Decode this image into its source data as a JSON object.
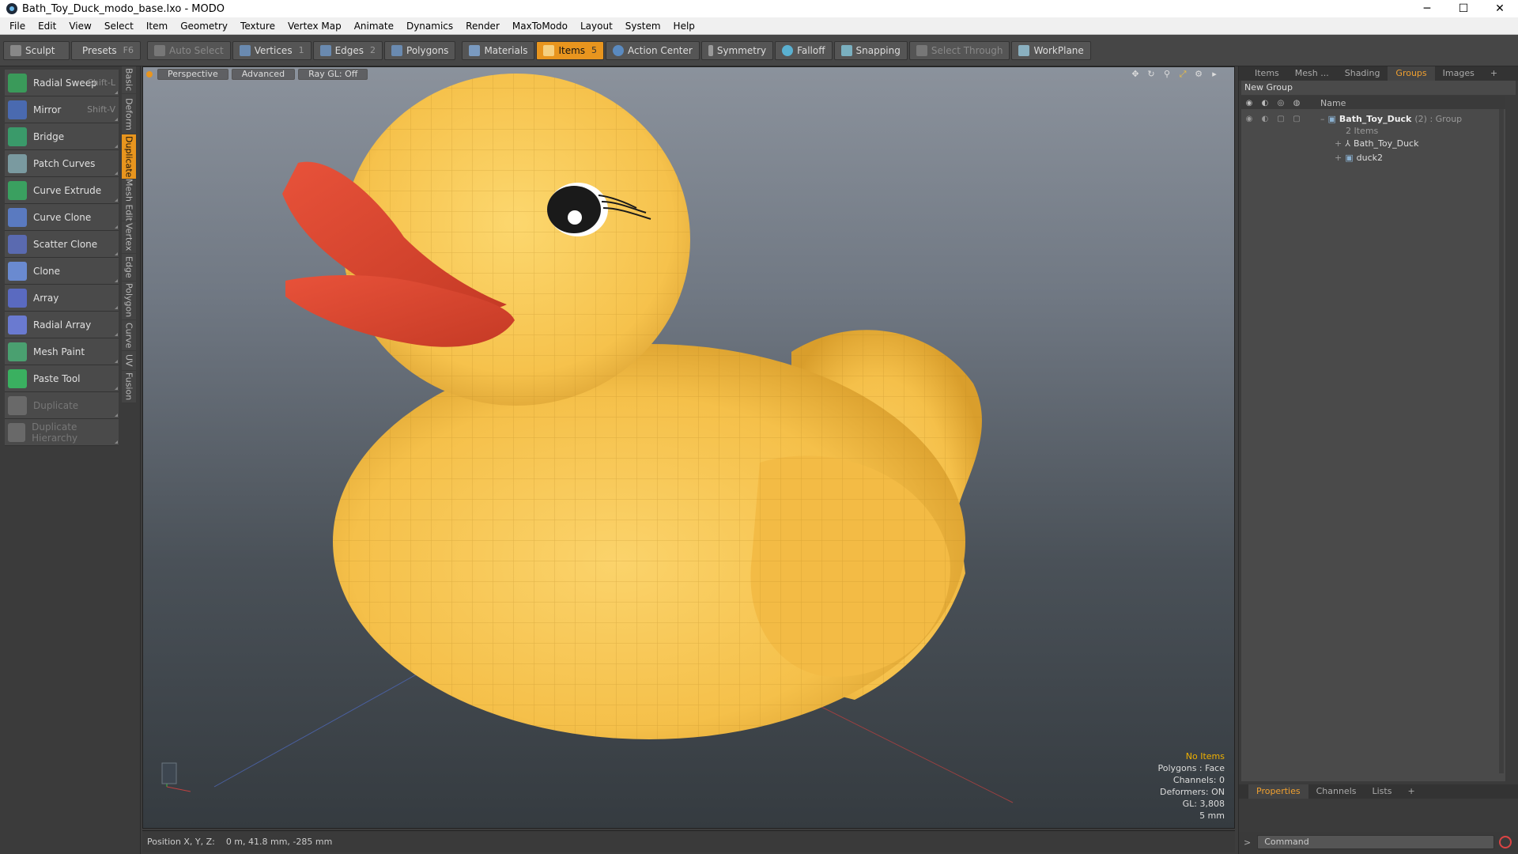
{
  "window": {
    "title": "Bath_Toy_Duck_modo_base.lxo - MODO",
    "min": "─",
    "max": "☐",
    "close": "✕"
  },
  "menu": [
    "File",
    "Edit",
    "View",
    "Select",
    "Item",
    "Geometry",
    "Texture",
    "Vertex Map",
    "Animate",
    "Dynamics",
    "Render",
    "MaxToModo",
    "Layout",
    "System",
    "Help"
  ],
  "toolbar": {
    "sculpt": "Sculpt",
    "presets": "Presets",
    "presets_shortcut": "F6",
    "auto_select": "Auto Select",
    "vertices": "Vertices",
    "vertices_count": "1",
    "edges": "Edges",
    "edges_count": "2",
    "polygons": "Polygons",
    "materials": "Materials",
    "items": "Items",
    "items_count": "5",
    "action_center": "Action Center",
    "symmetry": "Symmetry",
    "falloff": "Falloff",
    "snapping": "Snapping",
    "select_through": "Select Through",
    "workplane": "WorkPlane"
  },
  "tools": [
    {
      "label": "Radial Sweep",
      "shortcut": "Shift-L",
      "color": "#3a9a5a"
    },
    {
      "label": "Mirror",
      "shortcut": "Shift-V",
      "color": "#4a6ab0"
    },
    {
      "label": "Bridge",
      "shortcut": "",
      "color": "#3a9a6a"
    },
    {
      "label": "Patch Curves",
      "shortcut": "",
      "color": "#7a9aa0"
    },
    {
      "label": "Curve Extrude",
      "shortcut": "",
      "color": "#3aa060"
    },
    {
      "label": "Curve Clone",
      "shortcut": "",
      "color": "#5a7ac0"
    },
    {
      "label": "Scatter Clone",
      "shortcut": "",
      "color": "#5a6ab0"
    },
    {
      "label": "Clone",
      "shortcut": "",
      "color": "#6a8ad0"
    },
    {
      "label": "Array",
      "shortcut": "",
      "color": "#5a6ac0"
    },
    {
      "label": "Radial Array",
      "shortcut": "",
      "color": "#6a7ad0"
    },
    {
      "label": "Mesh Paint",
      "shortcut": "",
      "color": "#4aa070"
    },
    {
      "label": "Paste Tool",
      "shortcut": "",
      "color": "#3ab060"
    },
    {
      "label": "Duplicate",
      "shortcut": "",
      "color": "#888888",
      "disabled": true
    },
    {
      "label": "Duplicate Hierarchy",
      "shortcut": "",
      "color": "#888888",
      "disabled": true
    }
  ],
  "vtabs": [
    {
      "label": "Basic",
      "h": 34
    },
    {
      "label": "Deform",
      "h": 50
    },
    {
      "label": "Duplicate",
      "h": 56,
      "active": true
    },
    {
      "label": "Mesh Edit",
      "h": 52
    },
    {
      "label": "Vertex",
      "h": 40
    },
    {
      "label": "Edge",
      "h": 34
    },
    {
      "label": "Polygon",
      "h": 48
    },
    {
      "label": "Curve",
      "h": 38
    },
    {
      "label": "UV",
      "h": 24
    },
    {
      "label": "Fusion",
      "h": 40
    }
  ],
  "viewport": {
    "view": "Perspective",
    "mode": "Advanced",
    "raygl": "Ray GL: Off",
    "info": {
      "no_items": "No Items",
      "polygons": "Polygons : Face",
      "channels": "Channels: 0",
      "deformers": "Deformers: ON",
      "gl": "GL: 3,808",
      "scale": "5 mm"
    }
  },
  "status": {
    "label": "Position X, Y, Z:",
    "value": "0 m, 41.8 mm, -285 mm"
  },
  "right": {
    "tabs": [
      "Items",
      "Mesh ...",
      "Shading",
      "Groups",
      "Images"
    ],
    "active_tab": "Groups",
    "new_group": "New Group",
    "name_col": "Name",
    "group_name": "Bath_Toy_Duck",
    "group_count": "(2) : Group",
    "group_sub": "2 Items",
    "child1": "Bath_Toy_Duck",
    "child2": "duck2",
    "bottom_tabs": [
      "Properties",
      "Channels",
      "Lists"
    ],
    "command_placeholder": "Command"
  },
  "colors": {
    "accent": "#e8951e",
    "duck_body": "#f7c95a",
    "duck_beak": "#e35a3c"
  }
}
